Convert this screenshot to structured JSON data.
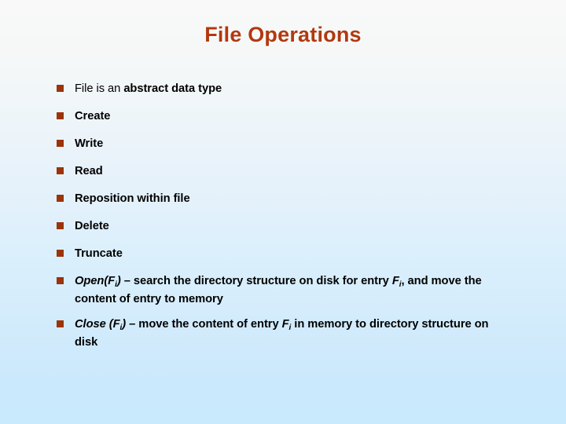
{
  "slide": {
    "title": "File Operations",
    "title_color": "#b1390f",
    "bullet_color": "#9c3309",
    "text_color": "#000000",
    "background_top_color": "#f8f9f8",
    "background_bottom_color": "#c9e9fc",
    "bullet_glyph": "filled-square"
  },
  "bullets": [
    {
      "id": "abstract-data-type",
      "plain": "File is an abstract data type",
      "lead_regular": "File is an ",
      "lead_bold": "abstract data type"
    },
    {
      "id": "create",
      "plain": "Create"
    },
    {
      "id": "write",
      "plain": "Write"
    },
    {
      "id": "read",
      "plain": "Read"
    },
    {
      "id": "reposition",
      "plain": "Reposition within file"
    },
    {
      "id": "delete",
      "plain": "Delete"
    },
    {
      "id": "truncate",
      "plain": "Truncate"
    },
    {
      "id": "open",
      "plain": "Open(Fi) – search the directory structure on disk for entry Fi, and move the content of entry to memory",
      "op_name": "Open(F",
      "op_sub": "i",
      "op_close": ")",
      "body_1": " – search the directory structure on disk for entry ",
      "var_2": "F",
      "var_2_sub": "i",
      "body_2": ", and move the content of entry to memory"
    },
    {
      "id": "close",
      "plain": "Close (Fi) – move the content of entry Fi in memory to directory structure on disk",
      "op_name": "Close (F",
      "op_sub": "i",
      "op_close": ")",
      "body_1": " – move the content of entry ",
      "var_2": "F",
      "var_2_sub": "i",
      "body_2": " in memory to directory structure on disk"
    }
  ]
}
